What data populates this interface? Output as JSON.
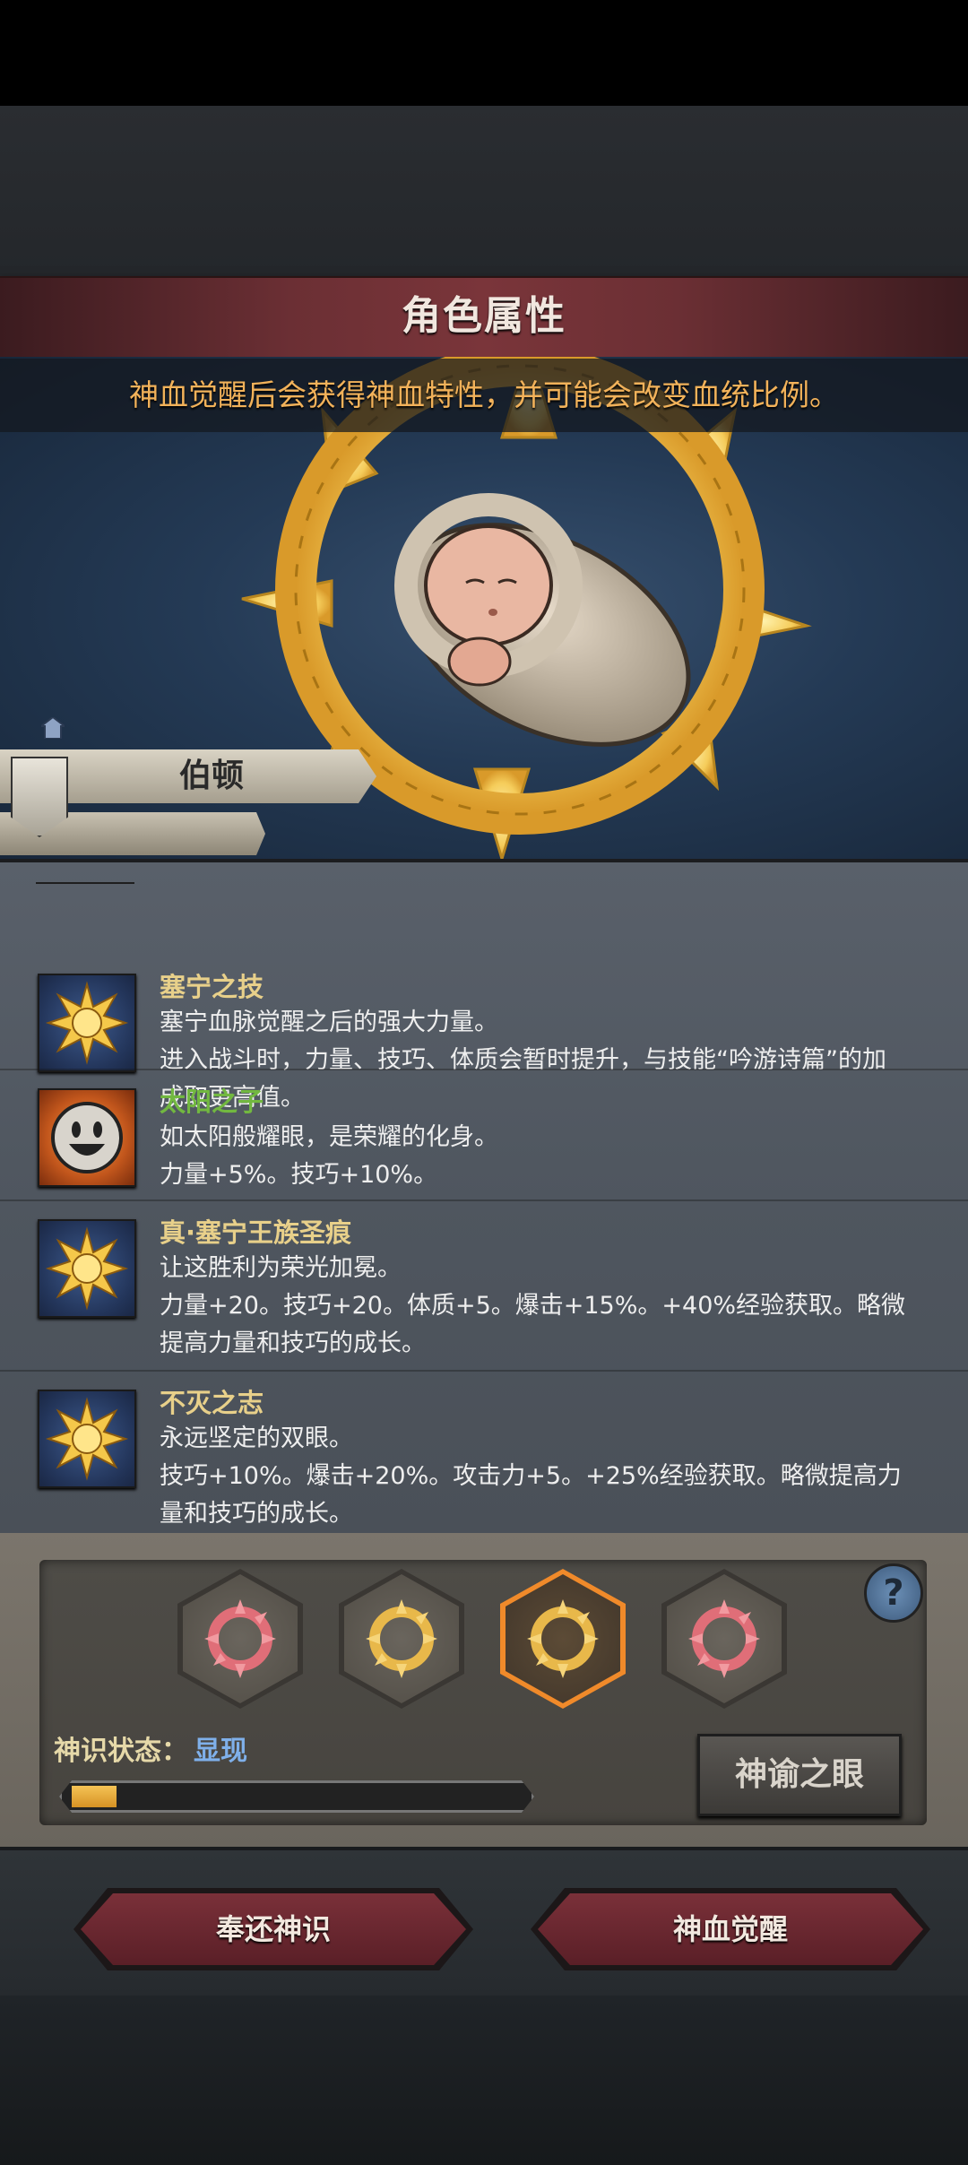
{
  "header": {
    "title": "角色属性"
  },
  "hero": {
    "info": "神血觉醒后会获得神血特性，并可能会改变血统比例。",
    "character_name": "伯顿"
  },
  "traits": [
    {
      "name": "塞宁之技",
      "name_color": "#e8d08a",
      "icon": "golden-sun-icon",
      "description": [
        "塞宁血脉觉醒之后的强大力量。",
        "进入战斗时，力量、技巧、体质会暂时提升，与技能“吟游诗篇”的加",
        "成取更高值。"
      ]
    },
    {
      "name": "太阳之子",
      "name_color": "#72b840",
      "icon": "smiley-face-icon",
      "description": [
        "如太阳般耀眼，是荣耀的化身。",
        "力量+5%。技巧+10%。"
      ]
    },
    {
      "name": "真·塞宁王族圣痕",
      "name_color": "#e8d08a",
      "icon": "golden-sun-icon",
      "description": [
        "让这胜利为荣光加冕。",
        "力量+20。技巧+20。体质+5。爆击+15%。+40%经验获取。略微",
        "提高力量和技巧的成长。"
      ]
    },
    {
      "name": "不灭之志",
      "name_color": "#e8d08a",
      "icon": "golden-sun-icon",
      "description": [
        "永远坚定的双眼。",
        "技巧+10%。爆击+20%。攻击力+5。+25%经验获取。略微提高力",
        "量和技巧的成长。"
      ]
    }
  ],
  "divine_sense": {
    "slots": [
      {
        "type": "red",
        "icon": "red-sun-ring-icon",
        "selected": false
      },
      {
        "type": "gold",
        "icon": "gold-sun-ring-icon",
        "selected": false
      },
      {
        "type": "gold",
        "icon": "gold-sun-ring-icon",
        "selected": true
      },
      {
        "type": "red",
        "icon": "red-sun-ring-icon",
        "selected": false
      }
    ],
    "status_label": "神识状态：",
    "status_value": "显现",
    "progress": 0.1,
    "oracle_button": "神谕之眼",
    "help_label": "?"
  },
  "actions": {
    "return_label": "奉还神识",
    "awaken_label": "神血觉醒"
  },
  "colors": {
    "accent_gold": "#f2b25a",
    "status_blue": "#7fb0ea",
    "button_red": "#6b2a32"
  }
}
